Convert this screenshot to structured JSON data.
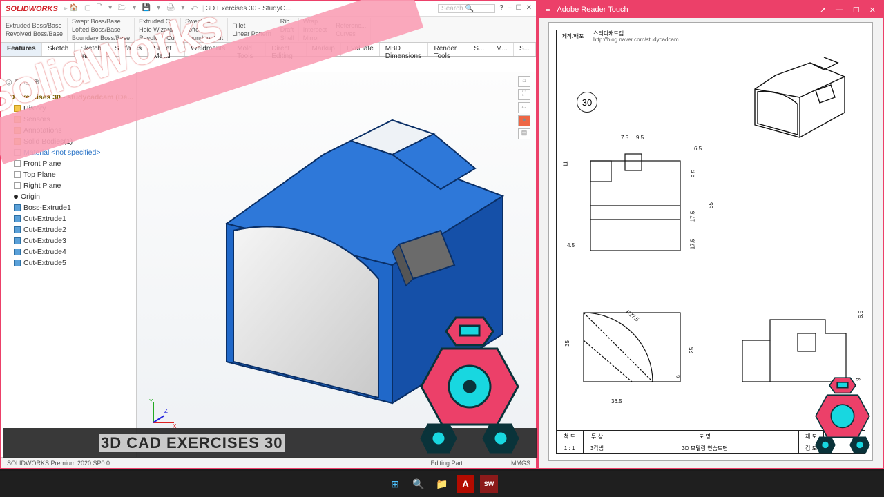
{
  "solidworks": {
    "brand": "SOLIDWORKS",
    "doc_title": "3D Exercises 30 - StudyC...",
    "search_placeholder": "Search Commands",
    "help_icon": "?",
    "ribbon": {
      "g1": {
        "a": "Extruded Boss/Base",
        "b": "Revolved Boss/Base"
      },
      "g2": {
        "a": "Swept Boss/Base",
        "b": "Lofted Boss/Base",
        "c": "Boundary Boss/Base"
      },
      "g3": {
        "a": "Extruded Cut",
        "b": "Hole Wizard",
        "c": "Revolved Cut"
      },
      "g4": {
        "a": "Swept Cut",
        "b": "Lofted Cut",
        "c": "Boundary Cut"
      },
      "g5": {
        "a": "Fillet",
        "b": "Linear Pattern"
      },
      "g6": {
        "a": "Rib",
        "b": "Draft",
        "c": "Shell"
      },
      "g7": {
        "a": "Wrap",
        "b": "Intersect",
        "c": "Mirror"
      },
      "g8": {
        "a": "Referenc...",
        "b": "Curves"
      }
    },
    "tabs": [
      "Features",
      "Sketch",
      "Sketch Ink",
      "Surfaces",
      "Sheet Metal",
      "Weldments",
      "Mold Tools",
      "Direct Editing",
      "Markup",
      "Evaluate",
      "MBD Dimensions",
      "Render Tools",
      "S...",
      "M...",
      "S..."
    ],
    "tree": {
      "root": "3D Exercises 30 - studycadcam  (De...",
      "items": [
        {
          "label": "History",
          "ico": "folder"
        },
        {
          "label": "Sensors",
          "ico": "folder"
        },
        {
          "label": "Annotations",
          "ico": "folder"
        },
        {
          "label": "Solid Bodies(1)",
          "ico": "folder"
        },
        {
          "label": "Material <not specified>",
          "ico": "mat"
        },
        {
          "label": "Front Plane",
          "ico": "plane"
        },
        {
          "label": "Top Plane",
          "ico": "plane"
        },
        {
          "label": "Right Plane",
          "ico": "plane"
        },
        {
          "label": "Origin",
          "ico": "point"
        },
        {
          "label": "Boss-Extrude1",
          "ico": "feat"
        },
        {
          "label": "Cut-Extrude1",
          "ico": "feat"
        },
        {
          "label": "Cut-Extrude2",
          "ico": "feat"
        },
        {
          "label": "Cut-Extrude3",
          "ico": "feat"
        },
        {
          "label": "Cut-Extrude4",
          "ico": "feat"
        },
        {
          "label": "Cut-Extrude5",
          "ico": "feat"
        }
      ]
    },
    "status": {
      "left": "SOLIDWORKS Premium 2020 SP0.0",
      "mid": "Editing Part",
      "right": "MMGS"
    }
  },
  "banner": {
    "brand": "SolidWorks",
    "subtitle": "3D CAD EXERCISES 30"
  },
  "pdf": {
    "app_title": "Adobe Reader Touch",
    "header": {
      "left": "제작/배포",
      "line1": "스터디캐드캠",
      "line2": "http://blog.naver.com/studycadcam"
    },
    "page_num": "30",
    "dims": {
      "d75": "7.5",
      "d95": "9.5",
      "d65": "6.5",
      "d11": "11",
      "d95b": "9.5",
      "d55": "55",
      "d45": "4.5",
      "d175": "17.5",
      "d175b": "17.5",
      "r275": "R27.5",
      "d35": "35",
      "d25": "25",
      "d9": "9",
      "d365": "36.5",
      "d65b": "6.5",
      "d9b": "9"
    },
    "titleblock": {
      "scale_h": "척 도",
      "proj_h": "투 상",
      "name_h": "도 명",
      "scale_v": "1 : 1",
      "proj_v": "3각법",
      "name_v": "3D 모델링 연습도면",
      "des_h": "제 도",
      "chk_h": "검 도"
    }
  },
  "taskbar": {
    "start": "⊞",
    "search": "🔍",
    "files": "📁",
    "acro": "A",
    "sw": "SW"
  }
}
